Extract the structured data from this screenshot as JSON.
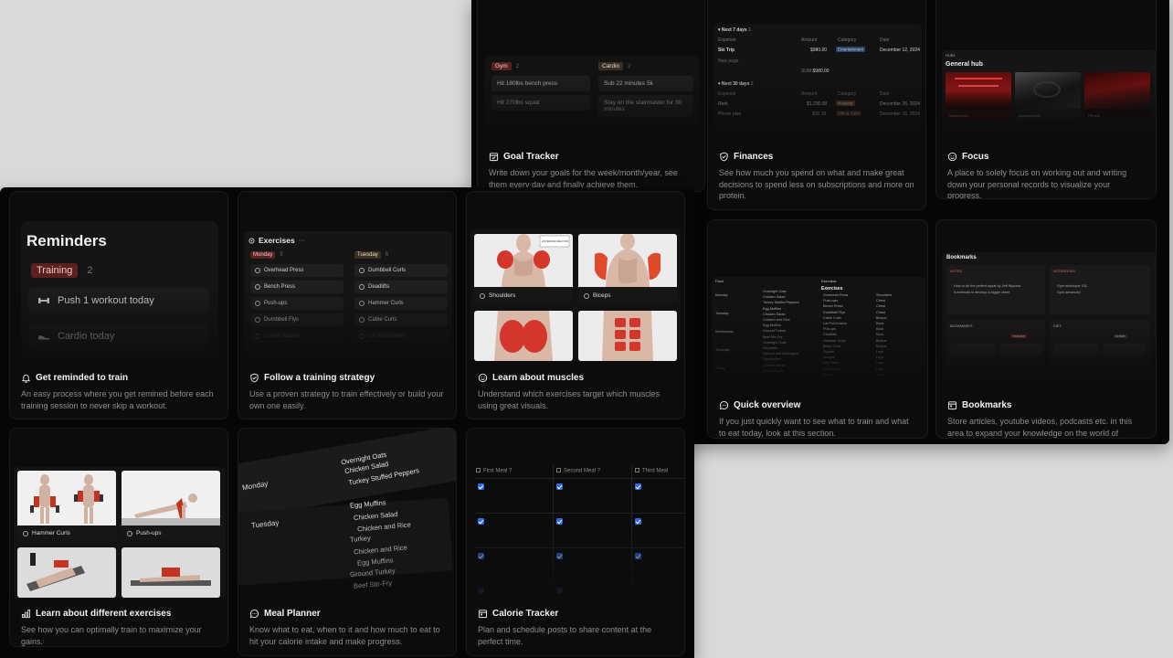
{
  "cards": {
    "goal": {
      "title": "Goal Tracker",
      "desc": "Write down your goals for the week/month/year, see them every day and finally achieve them.",
      "preview": {
        "col1_tag": "Gym",
        "col1_count": "2",
        "col2_tag": "Cardio",
        "col2_count": "2",
        "col1_items": [
          "Hit 180lbs bench press",
          "Hit 270lbs squat"
        ],
        "col2_items": [
          "Sub 22 minutes 5k",
          "Stay on the stairmaster for 30 minutes"
        ]
      }
    },
    "finances": {
      "title": "Finances",
      "desc": "See how much you spend on what and make great decisions to spend less on subscriptions and more on protein.",
      "preview": {
        "section1": "Next 7 days",
        "section1_count": "1",
        "headers": [
          "Expense",
          "Amount",
          "Category",
          "Date"
        ],
        "row1": {
          "name": "Ski Trip",
          "amount": "$980.00",
          "category": "Entertainment",
          "date": "December 12, 2024"
        },
        "new_page": "New page",
        "sum_label": "SUM",
        "sum_value": "$980.00",
        "section2": "Next 30 days",
        "section2_count": "2",
        "row2": {
          "name": "Rent",
          "amount": "$1,230.00",
          "category": "Housing",
          "date": "December 26, 2024"
        },
        "row3": {
          "name": "Phone plan",
          "amount": "$32.10",
          "category": "Bills & Subs",
          "date": "December 16, 2024"
        }
      }
    },
    "focus": {
      "title": "Focus",
      "desc": "A place to solely focus on working out and writing down your personal records to visualize your progress.",
      "preview": {
        "breadcrumb": "Hubs",
        "title": "General hub",
        "tiles": [
          "Workout hub",
          "Important hub",
          "PR hub"
        ]
      }
    },
    "reminders": {
      "title": "Get reminded to train",
      "desc": "An easy process where you get remined before each training session to never skip a workout.",
      "preview": {
        "heading": "Reminders",
        "tag": "Training",
        "count": "2",
        "items": [
          "Push 1 workout today",
          "Cardio today"
        ]
      }
    },
    "strategy": {
      "title": "Follow a training strategy",
      "desc": "Use a proven strategy to train effectively or build your own one easily.",
      "preview": {
        "heading": "Exercises",
        "col1_tag": "Monday",
        "col1_count": "5",
        "col2_tag": "Tuesday",
        "col2_count": "6",
        "col1_items": [
          "Overhead Press",
          "Bench Press",
          "Push-ups",
          "Dumbbell Flys",
          "Lateral Raises"
        ],
        "col2_items": [
          "Dumbbell Curls",
          "Deadlifts",
          "Hammer Curls",
          "Cable Curls",
          "Lat Pull-Downs"
        ]
      }
    },
    "muscles": {
      "title": "Learn about muscles",
      "desc": "Understand which exercises target which muscles using great visuals.",
      "preview": {
        "tiles": [
          "Shoulders",
          "Biceps"
        ],
        "caption": "ANTERIOR DELTOID"
      }
    },
    "overview": {
      "title": "Quick overview",
      "desc": "If you just quickly want to see what to train and what to eat today, look at this section.",
      "preview": {
        "left_title": "Food",
        "right_title": "Exercises",
        "days": [
          "Monday",
          "Tuesday",
          "Wednesday",
          "Thursday",
          "Friday"
        ],
        "foods": [
          "Overnight Oats",
          "Chicken Salad",
          "Turkey Stuffed Peppers",
          "Egg Muffins",
          "Chicken Salad",
          "Chicken and Rice",
          "Egg Muffins",
          "Ground Turkey",
          "Beef Stir-Fry",
          "Overnight Oats",
          "Smoothie",
          "Salmon and Asparagus",
          "Egg Muffins",
          "Chicken Salad",
          "Greek Yogurt"
        ],
        "exercises": [
          "Overhead Press",
          "Push-ups",
          "Bench Press",
          "Dumbbell Flys",
          "Cable Curls",
          "Lat Pull-Downs",
          "Pull-ups",
          "Deadlifts",
          "Hammer Curls",
          "Bicep Curls",
          "Squats",
          "Lunges",
          "Leg Press",
          "Calf Raises",
          "Plank"
        ],
        "muscles": [
          "Shoulders",
          "Chest",
          "Chest",
          "Chest",
          "Biceps",
          "Back",
          "Back",
          "Back",
          "Biceps",
          "Biceps",
          "Legs",
          "Legs",
          "Legs",
          "Legs",
          "Core"
        ]
      }
    },
    "bookmarks": {
      "title": "Bookmarks",
      "desc": "Store articles, youtube videos, podcasts etc. in this area to expand your knowledge on the world of fitness.",
      "preview": {
        "heading": "Bookmarks",
        "notes_label": "NOTES",
        "notebooks_label": "NOTEBOOKS",
        "notes": [
          "How to do the perfect squat by Jeff Nippard",
          "5 methods to develop a bigger chest"
        ],
        "notebooks": [
          "Gym technique 101",
          "Gym advanced"
        ],
        "bookmarks_label": "BOOKMARKS",
        "diet_label": "DIET",
        "tag_youtube": "Youtube",
        "tag_article": "Article"
      }
    },
    "exercises": {
      "title": "Learn about different exercises",
      "desc": "See how you can optimally train to maximize your gains.",
      "preview": {
        "tiles": [
          "Hammer Curls",
          "Push-ups"
        ]
      }
    },
    "meal": {
      "title": "Meal Planner",
      "desc": "Know what to eat, when to it and how much to eat to hit your calorie intake and make progress.",
      "preview": {
        "day1": "Monday",
        "day2": "Tuesday",
        "monday_items": [
          "Overnight Oats",
          "Chicken Salad",
          "Turkey Stuffed Peppers"
        ],
        "tuesday_items": [
          "Egg Muffins",
          "Chicken Salad",
          "Chicken and Rice",
          "Turkey",
          "Chicken and Rice",
          "Egg Muffins",
          "Ground Turkey",
          "Beef Stir-Fry"
        ]
      }
    },
    "calorie": {
      "title": "Calorie Tracker",
      "desc": "Plan and schedule posts to share content at the perfect time.",
      "preview": {
        "headers": [
          "First Meal ?",
          "Second Meal ?",
          "Third Meal"
        ]
      }
    }
  },
  "colors": {
    "page_bg": "#d9d9d9",
    "panel_bg": "#060606",
    "card_bg": "#0c0c0c",
    "tag_red": "#5a1f1f",
    "tag_brown": "#3a2e22",
    "checkbox_blue": "#2d6be0",
    "pill_blue": "#28436e"
  }
}
